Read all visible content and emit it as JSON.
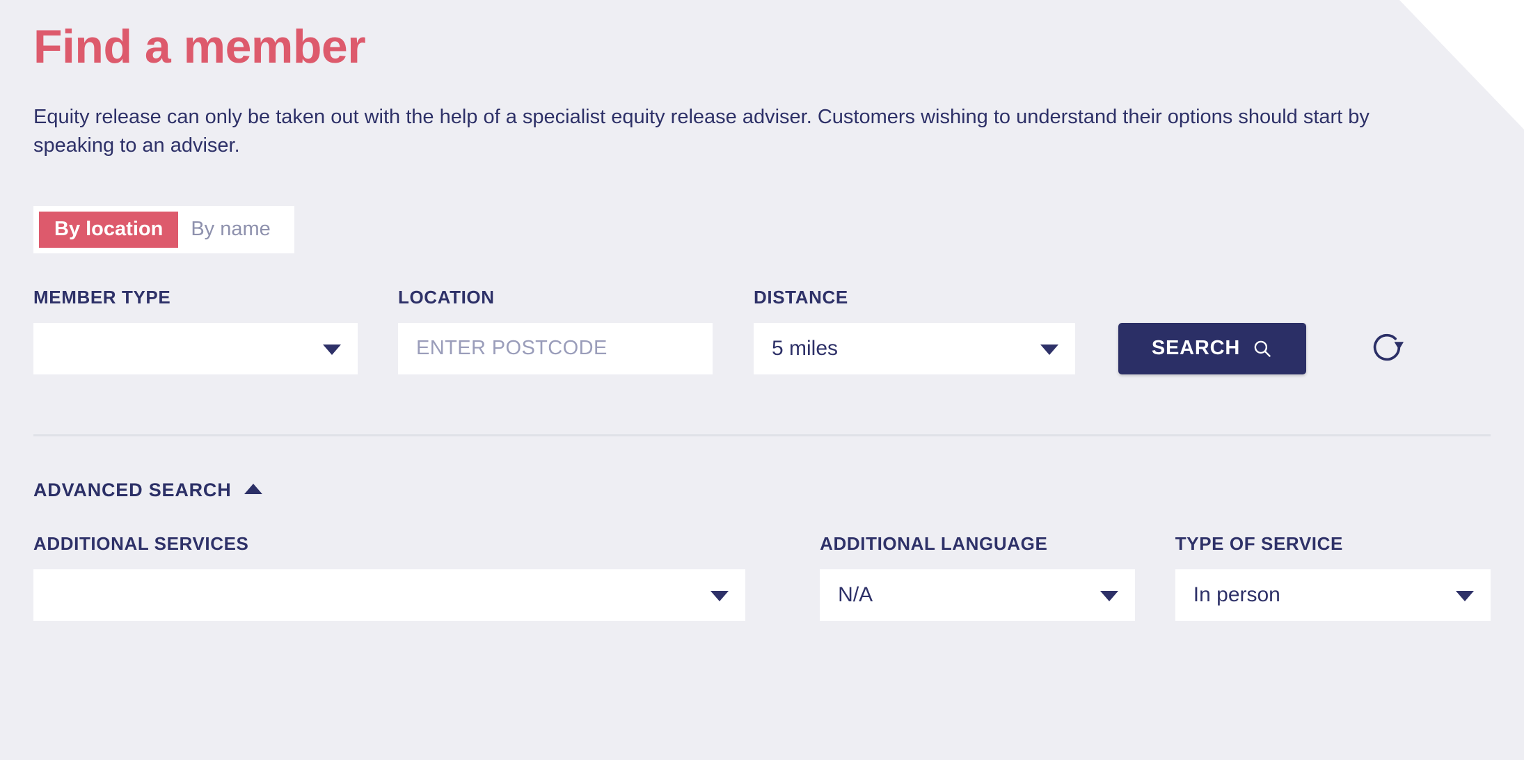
{
  "page": {
    "title": "Find a member",
    "intro": "Equity release can only be taken out with the help of a specialist equity release adviser. Customers wishing to understand their options should start by speaking to an adviser."
  },
  "colors": {
    "background": "#eeeef3",
    "accent_red": "#dd5a6c",
    "navy": "#2b2f66",
    "muted": "#8e91ad",
    "field_bg": "#ffffff",
    "divider": "#dfe1e7"
  },
  "search_mode": {
    "by_location_label": "By location",
    "by_name_label": "By name",
    "active": "By location"
  },
  "primary_filters": {
    "member_type": {
      "label": "MEMBER TYPE",
      "value": "",
      "icon": "chevron-down-icon"
    },
    "location": {
      "label": "LOCATION",
      "value": "",
      "placeholder": "ENTER POSTCODE"
    },
    "distance": {
      "label": "DISTANCE",
      "value": "5 miles",
      "icon": "chevron-down-icon"
    }
  },
  "actions": {
    "search_label": "SEARCH",
    "search_icon": "magnifier-icon",
    "reset_icon": "refresh-circular-arrow-icon"
  },
  "advanced_search": {
    "label": "ADVANCED SEARCH",
    "expanded": true,
    "toggle_icon": "chevron-up-icon",
    "fields": {
      "additional_services": {
        "label": "ADDITIONAL SERVICES",
        "value": "",
        "icon": "chevron-down-icon"
      },
      "additional_language": {
        "label": "ADDITIONAL LANGUAGE",
        "value": "N/A",
        "icon": "chevron-down-icon"
      },
      "type_of_service": {
        "label": "TYPE OF SERVICE",
        "value": "In person",
        "icon": "chevron-down-icon"
      }
    }
  }
}
